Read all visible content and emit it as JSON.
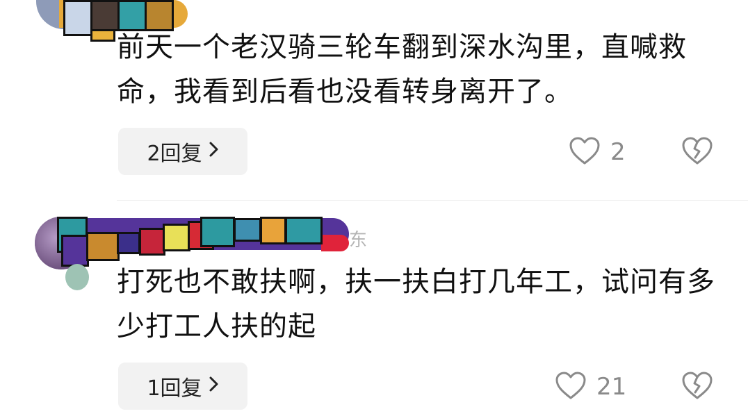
{
  "comments": [
    {
      "text": "前天一个老汉骑三轮车翻到深水沟里，直喊救命，我看到后看也没看转身离开了。",
      "reply_label": "2回复",
      "like_count": "2"
    },
    {
      "location_suffix": "东",
      "text": "打死也不敢扶啊，扶一扶白打几年工，试问有多少打工人扶的起",
      "reply_label": "1回复",
      "like_count": "21"
    }
  ],
  "icons": {
    "reply_chevron": "chevron-right-icon",
    "like": "heart-outline-icon",
    "dislike": "broken-heart-icon"
  },
  "colors": {
    "reply_bg": "#f2f2f2",
    "count": "#8a8a8a",
    "redaction_purple": "#55349a",
    "redaction_teal": "#2d9aa0",
    "redaction_orange": "#e7a83a",
    "redaction_red": "#e0233a"
  }
}
